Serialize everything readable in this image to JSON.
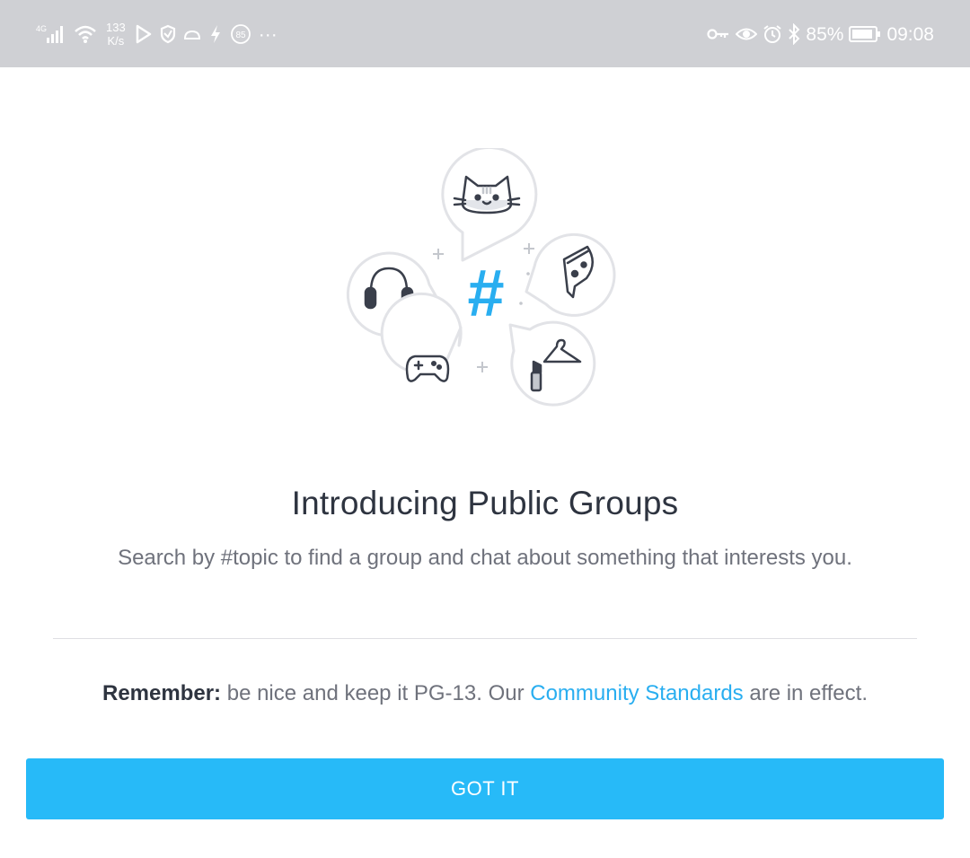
{
  "status_bar": {
    "network_type": "4G",
    "net_speed_value": "133",
    "net_speed_unit": "K/s",
    "notification_badge": "85",
    "overflow": "···",
    "battery_percent": "85%",
    "time": "09:08",
    "left_icons": [
      "signal-icon",
      "wifi-icon",
      "play-store-icon",
      "shield-icon",
      "cloud-icon",
      "flash-icon",
      "badge-icon",
      "more-icon"
    ],
    "right_icons": [
      "key-icon",
      "eye-icon",
      "alarm-icon",
      "bluetooth-icon",
      "battery-icon"
    ]
  },
  "illustration": {
    "center_symbol": "#",
    "bubbles": [
      "cat-icon",
      "headphones-icon",
      "pizza-icon",
      "gamepad-icon",
      "fashion-icon"
    ],
    "accent_color": "#29aef0"
  },
  "intro": {
    "title": "Introducing Public Groups",
    "subtitle": "Search by #topic to find a group and chat about something that interests you."
  },
  "remember": {
    "label": "Remember:",
    "text_before": " be nice and keep it PG-13. Our ",
    "link": "Community Standards",
    "text_after": " are in effect."
  },
  "button": {
    "label": "GOT IT",
    "color": "#27baf8"
  }
}
